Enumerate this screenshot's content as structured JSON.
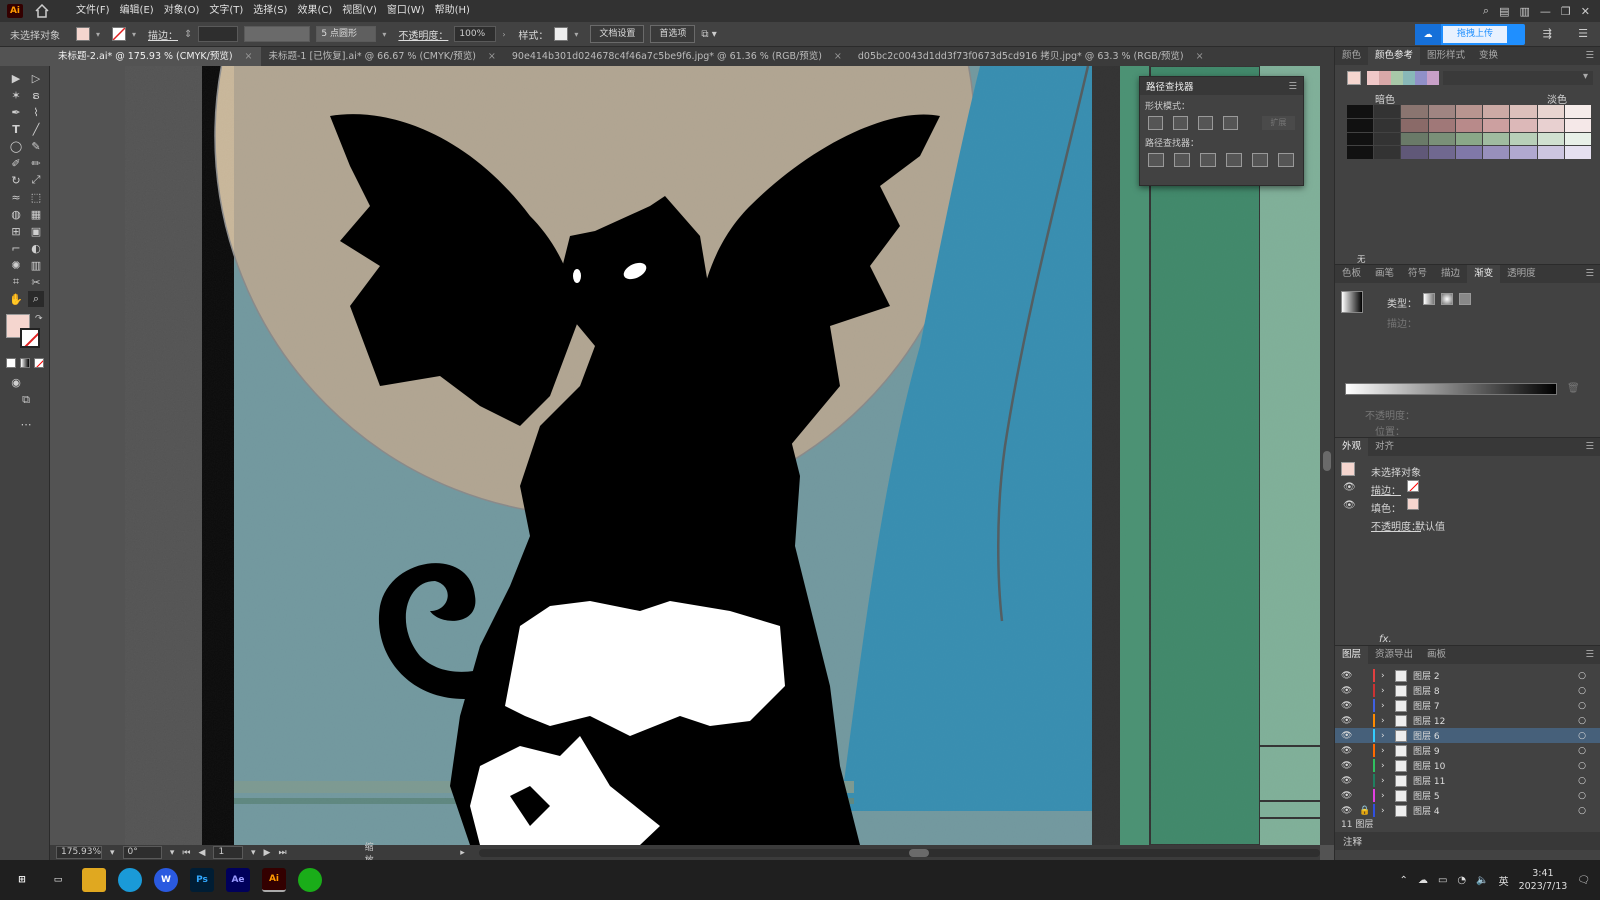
{
  "app": {
    "logo": "Ai"
  },
  "menu": [
    "文件(F)",
    "编辑(E)",
    "对象(O)",
    "文字(T)",
    "选择(S)",
    "效果(C)",
    "视图(V)",
    "窗口(W)",
    "帮助(H)"
  ],
  "control": {
    "selection": "未选择对象",
    "stroke_label": "描边：",
    "brush": "5 点圆形",
    "opacity_label": "不透明度：",
    "opacity": "100%",
    "style_label": "样式：",
    "doc_setup": "文档设置",
    "prefs": "首选项",
    "upload": "拖拽上传"
  },
  "tabs": [
    {
      "label": "未标题-2.ai* @ 175.93 % (CMYK/预览)",
      "active": true
    },
    {
      "label": "未标题-1 [已恢复].ai* @ 66.67 % (CMYK/预览)",
      "active": false
    },
    {
      "label": "90e414b301d024678c4f46a7c5be9f6.jpg* @ 61.36 % (RGB/预览)",
      "active": false
    },
    {
      "label": "d05bc2c0043d1dd3f73f0673d5cd916 拷贝.jpg* @ 63.3 % (RGB/预览)",
      "active": false
    }
  ],
  "tab_close": "×",
  "pathfinder": {
    "title": "路径查找器",
    "shape_modes": "形状模式：",
    "expand": "扩展",
    "pathfinders": "路径查找器："
  },
  "color_panel": {
    "tabs": [
      "颜色",
      "颜色参考",
      "图形样式",
      "变换"
    ],
    "dark": "暗色",
    "light": "淡色",
    "none_label": "无"
  },
  "gradient_panel": {
    "tabs": [
      "色板",
      "画笔",
      "符号",
      "描边",
      "渐变",
      "透明度"
    ],
    "type_label": "类型：",
    "stroke_label": "描边：",
    "opacity_label": "不透明度：",
    "position_label": "位置："
  },
  "appearance_panel": {
    "tabs": [
      "外观",
      "对齐"
    ],
    "object": "未选择对象",
    "stroke": "描边：",
    "fill": "填色：",
    "opacity": "不透明度：",
    "opacity_value": "默认值",
    "fx": "fx."
  },
  "layers_panel": {
    "tabs": [
      "图层",
      "资源导出",
      "画板"
    ],
    "count": "11 图层",
    "comment": "注释",
    "layers": [
      {
        "name": "图层 2",
        "color": "#e04040",
        "selected": false
      },
      {
        "name": "图层 8",
        "color": "#cc3333",
        "selected": false
      },
      {
        "name": "图层 7",
        "color": "#4060e0",
        "selected": false
      },
      {
        "name": "图层 12",
        "color": "#ff8a00",
        "selected": false
      },
      {
        "name": "图层 6",
        "color": "#33ccff",
        "selected": true
      },
      {
        "name": "图层 9",
        "color": "#ff6a00",
        "selected": false
      },
      {
        "name": "图层 10",
        "color": "#30c060",
        "selected": false
      },
      {
        "name": "图层 11",
        "color": "#208060",
        "selected": false
      },
      {
        "name": "图层 5",
        "color": "#e040e0",
        "selected": false
      },
      {
        "name": "图层 4",
        "color": "#3050e0",
        "selected": false
      }
    ]
  },
  "status": {
    "zoom": "175.93%",
    "rotation": "0°",
    "artboard": "1",
    "mode": "缩放"
  },
  "taskbar": {
    "apps": [
      "Ps",
      "Ae",
      "Ai"
    ],
    "ime": "英",
    "time": "3:41",
    "date": "2023/7/13"
  }
}
